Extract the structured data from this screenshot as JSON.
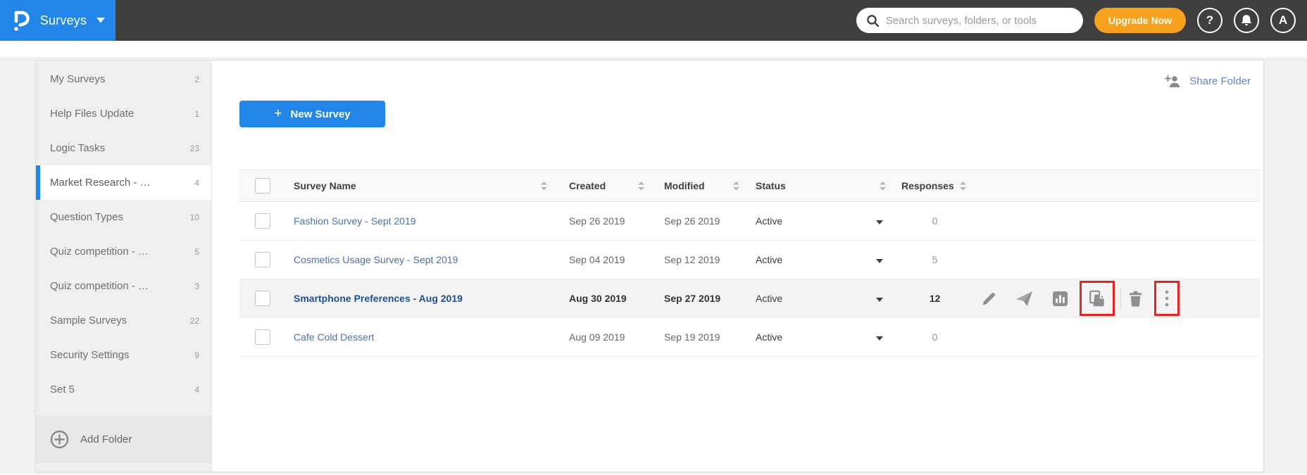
{
  "navbar": {
    "product": "Surveys",
    "search": {
      "placeholder": "Search surveys, folders, or tools"
    },
    "upgrade_label": "Upgrade Now",
    "help_glyph": "?",
    "avatar_initial": "A"
  },
  "sidebar": {
    "items": [
      {
        "label": "My Surveys",
        "count": "2"
      },
      {
        "label": "Help Files Update",
        "count": "1"
      },
      {
        "label": "Logic Tasks",
        "count": "23"
      },
      {
        "label": "Market Research - …",
        "count": "4",
        "selected": true
      },
      {
        "label": "Question Types",
        "count": "10"
      },
      {
        "label": "Quiz competition - …",
        "count": "5"
      },
      {
        "label": "Quiz competition - …",
        "count": "3"
      },
      {
        "label": "Sample Surveys",
        "count": "22"
      },
      {
        "label": "Security Settings",
        "count": "9"
      },
      {
        "label": "Set 5",
        "count": "4"
      }
    ],
    "add_folder_label": "Add Folder"
  },
  "main": {
    "share_folder_label": "Share Folder",
    "new_survey": {
      "plus": "+",
      "label": "New Survey"
    },
    "table": {
      "headers": {
        "name": "Survey Name",
        "created": "Created",
        "modified": "Modified",
        "status": "Status",
        "responses": "Responses"
      },
      "rows": [
        {
          "name": "Fashion Survey - Sept 2019",
          "created": "Sep 26 2019",
          "modified": "Sep 26 2019",
          "status": "Active",
          "responses": "0"
        },
        {
          "name": "Cosmetics Usage Survey - Sept 2019",
          "created": "Sep 04 2019",
          "modified": "Sep 12 2019",
          "status": "Active",
          "responses": "5"
        },
        {
          "name": "Smartphone Preferences - Aug 2019",
          "created": "Aug 30 2019",
          "modified": "Sep 27 2019",
          "status": "Active",
          "responses": "12",
          "highlighted": true
        },
        {
          "name": "Cafe Cold Dessert",
          "created": "Aug 09 2019",
          "modified": "Sep 19 2019",
          "status": "Active",
          "responses": "0"
        }
      ]
    }
  },
  "colors": {
    "accent_blue": "#2286e8",
    "navbar_dark": "#3f3f3f",
    "upgrade_orange": "#f6a21e",
    "annotation_red": "#e5242a",
    "link_blue": "#4a72ab"
  }
}
